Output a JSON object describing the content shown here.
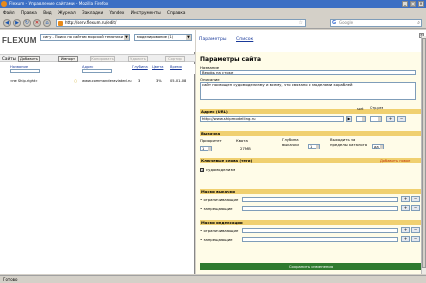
{
  "window": {
    "title": "Flexum - Управление сайтами - Mozilla Firefox"
  },
  "menu": [
    "Файл",
    "Правка",
    "Вид",
    "Журнал",
    "Закладки",
    "Yandex",
    "Инструменты",
    "Справка"
  ],
  "nav": {
    "url": "http://serv.flexum.ru/edit/",
    "search_placeholder": "Google"
  },
  "left": {
    "logo": "FLEXUM",
    "project_select": "сигу - Поиск по сайтам морской тематики",
    "type_select": "моделирование (1)",
    "sites_label": "Сайты",
    "buttons": [
      "Добавить",
      "Импорт",
      "Копировать",
      "Удалить",
      "Сортир"
    ],
    "columns": [
      "Название",
      "Адрес",
      "Глубина",
      "Цвета",
      "Время"
    ],
    "rows": [
      {
        "name": "«не Ship.right»",
        "url": "www.сommanderaviated.ru",
        "depth": "3",
        "pct": "3%",
        "time": "05-01-08"
      }
    ]
  },
  "right": {
    "tabs": [
      "Параметры",
      "Список"
    ],
    "title": "Параметры сайта",
    "name_label": "Название",
    "name_value": "Верфь на стоке",
    "desc_label": "Описание",
    "desc_value": "сайт посвящен судомоделизму и всему, что связано с моделями кораблей",
    "addr_section": "Адрес (URL)",
    "addr_value": "http://www.shipmodelling.ru",
    "addr_sort": "sort",
    "addr_pages": "Стр.рез",
    "fetch_section": "Выкачка",
    "fetch_labels": [
      "Приоритет",
      "Квота",
      "Глубина выкачки",
      "Выходить за пределы каталога"
    ],
    "fetch_values": [
      "1",
      "27MB",
      "1",
      "да"
    ],
    "keywords_section": "Ключевые слова (теги)",
    "keywords_add": "Добавить новое",
    "keyword_tag": "судомоделизм",
    "mask_fetch_section": "Маски выкачки",
    "mask_labels": [
      "ограничивающие",
      "запрещающие"
    ],
    "mask_index_section": "Маски индексации",
    "save_label": "Сохранить изменения"
  },
  "status": "Готово",
  "colors": {
    "accent": "#3c6fc4",
    "section": "#f0d070",
    "save": "#2f7a2f"
  }
}
